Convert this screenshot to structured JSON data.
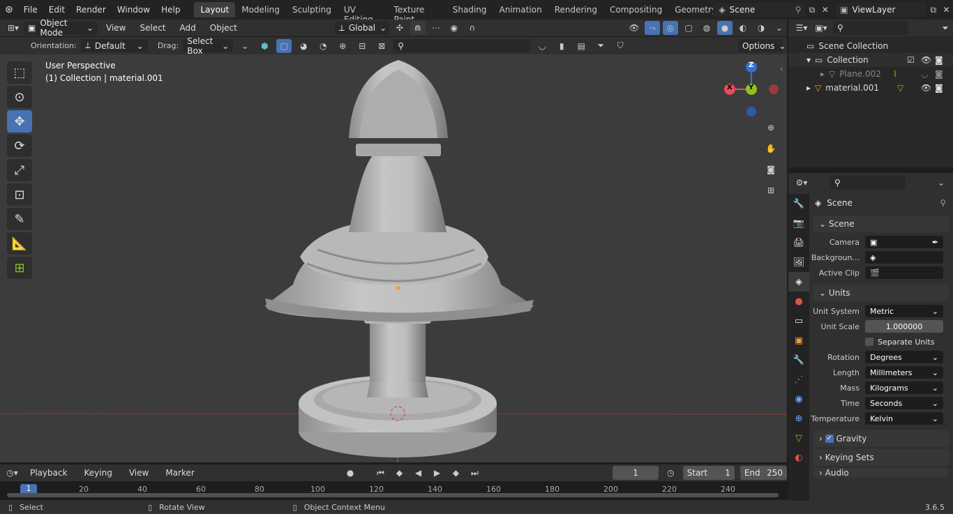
{
  "topbar": {
    "menus": [
      "File",
      "Edit",
      "Render",
      "Window",
      "Help"
    ],
    "workspaces": [
      "Layout",
      "Modeling",
      "Sculpting",
      "UV Editing",
      "Texture Paint",
      "Shading",
      "Animation",
      "Rendering",
      "Compositing",
      "Geometry Noc"
    ],
    "active_workspace": "Layout",
    "scene": "Scene",
    "view_layer": "ViewLayer"
  },
  "viewport_header": {
    "mode": "Object Mode",
    "menus": [
      "View",
      "Select",
      "Add",
      "Object"
    ],
    "transform_orientation": "Global",
    "orientation_label": "Orientation:",
    "orientation_value": "Default",
    "drag_label": "Drag:",
    "drag_value": "Select Box",
    "options": "Options"
  },
  "viewport": {
    "title": "User Perspective",
    "subtitle": "(1) Collection | material.001",
    "gizmo": {
      "z": "Z",
      "y": "Y",
      "x": "X"
    }
  },
  "timeline": {
    "menus": [
      "Playback",
      "Keying",
      "View",
      "Marker"
    ],
    "current_frame": "1",
    "start_label": "Start",
    "start": "1",
    "end_label": "End",
    "end": "250",
    "ticks": [
      "1",
      "20",
      "40",
      "60",
      "80",
      "100",
      "120",
      "140",
      "160",
      "180",
      "200",
      "220",
      "240"
    ]
  },
  "status": {
    "select": "Select",
    "rotate": "Rotate View",
    "context": "Object Context Menu",
    "version": "3.6.5"
  },
  "outliner": {
    "scene_collection": "Scene Collection",
    "items": [
      {
        "label": "Collection",
        "level": 1
      },
      {
        "label": "Plane.002",
        "level": 2
      },
      {
        "label": "material.001",
        "level": 1
      }
    ]
  },
  "properties": {
    "header": "Scene",
    "scene_panel": {
      "title": "Scene",
      "camera_label": "Camera",
      "background_label": "Backgroun...",
      "clip_label": "Active Clip"
    },
    "units_panel": {
      "title": "Units",
      "rows": [
        {
          "label": "Unit System",
          "value": "Metric",
          "type": "dropdown"
        },
        {
          "label": "Unit Scale",
          "value": "1.000000",
          "type": "number"
        },
        {
          "label": "",
          "value": "Separate Units",
          "type": "checkbox"
        },
        {
          "label": "Rotation",
          "value": "Degrees",
          "type": "dropdown"
        },
        {
          "label": "Length",
          "value": "Millimeters",
          "type": "dropdown"
        },
        {
          "label": "Mass",
          "value": "Kilograms",
          "type": "dropdown"
        },
        {
          "label": "Time",
          "value": "Seconds",
          "type": "dropdown"
        },
        {
          "label": "Temperature",
          "value": "Kelvin",
          "type": "dropdown"
        }
      ]
    },
    "collapsed_panels": [
      "Gravity",
      "Keying Sets",
      "Audio"
    ]
  },
  "colors": {
    "accent": "#4772b3",
    "x_axis": "#e44e5b",
    "y_axis": "#8bc21b",
    "z_axis": "#2f72d8"
  }
}
